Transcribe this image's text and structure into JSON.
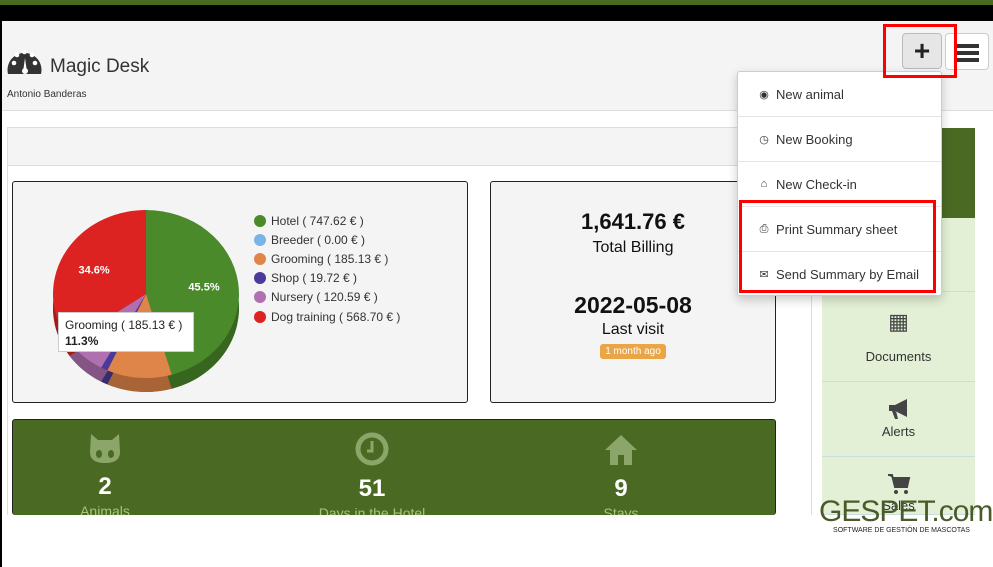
{
  "app": {
    "title": "Magic Desk",
    "user": "Antonio Banderas"
  },
  "toolbar": {
    "add_icon": "plus-icon",
    "menu_icon": "hamburger-icon"
  },
  "dropdown": {
    "items": [
      {
        "label": "New animal",
        "icon": "cat-icon"
      },
      {
        "label": "New Booking",
        "icon": "clock-icon"
      },
      {
        "label": "New Check-in",
        "icon": "home-icon"
      },
      {
        "label": "Print Summary sheet",
        "icon": "print-icon"
      },
      {
        "label": "Send Summary by Email",
        "icon": "envelope-icon"
      }
    ]
  },
  "chart_data": {
    "type": "pie",
    "categories": [
      "Hotel",
      "Breeder",
      "Grooming",
      "Shop",
      "Nursery",
      "Dog training"
    ],
    "values": [
      747.62,
      0.0,
      185.13,
      19.72,
      120.59,
      568.7
    ],
    "legend": [
      "Hotel ( 747.62 € )",
      "Breeder ( 0.00 € )",
      "Grooming ( 185.13 € )",
      "Shop ( 19.72 € )",
      "Nursery ( 120.59 € )",
      "Dog training ( 568.70 € )"
    ],
    "colors": [
      "#4a8a2a",
      "#7ab3e6",
      "#e0854a",
      "#4a3a9a",
      "#b070b0",
      "#dd2222"
    ],
    "data_labels": {
      "Hotel": "45.5%",
      "Dog training": "34.6%"
    },
    "tooltip": {
      "title": "Grooming ( 185.13 € )",
      "value": "11.3%"
    },
    "legend_position": "right"
  },
  "summary": {
    "total": "1,641.76 €",
    "total_label": "Total Billing",
    "last_visit": "2022-05-08",
    "last_visit_label": "Last visit",
    "badge": "1 month ago"
  },
  "stats": [
    {
      "value": "2",
      "label": "Animals",
      "icon": "cat-icon"
    },
    {
      "value": "51",
      "label": "Days in the Hotel",
      "icon": "clock-icon"
    },
    {
      "value": "9",
      "label": "Stays",
      "icon": "home-icon"
    }
  ],
  "sidebar": {
    "items": [
      {
        "label": "Documents",
        "icon": "book-icon"
      },
      {
        "label": "Alerts",
        "icon": "bullhorn-icon"
      },
      {
        "label": "Sales",
        "icon": "cart-icon"
      }
    ]
  },
  "brand": {
    "logo": "GESPET.com",
    "tagline": "SOFTWARE DE GESTIÓN DE MASCOTAS"
  },
  "colors": {
    "brand_green": "#4a6a24",
    "highlight": "#ff0000"
  }
}
